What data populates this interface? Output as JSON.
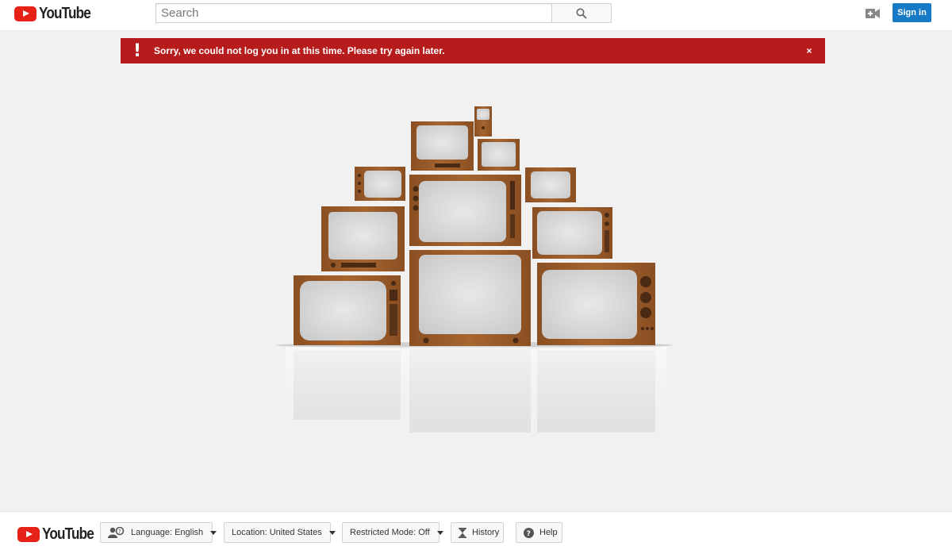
{
  "header": {
    "logo_text": "YouTube",
    "search_placeholder": "Search",
    "signin_label": "Sign in",
    "colors": {
      "brand_red": "#e62117",
      "signin_blue": "#167ac6"
    }
  },
  "alert": {
    "icon": "exclamation-icon",
    "message": "Sorry, we could not log you in at this time. Please try again later.",
    "close_label": "×",
    "color": "#b71c1c"
  },
  "footer": {
    "logo_text": "YouTube",
    "language": {
      "label": "Language:",
      "value": "English"
    },
    "location": {
      "label": "Location:",
      "value": "United States"
    },
    "restricted": {
      "label": "Restricted Mode:",
      "value": "Off"
    },
    "history_label": "History",
    "help_label": "Help"
  }
}
